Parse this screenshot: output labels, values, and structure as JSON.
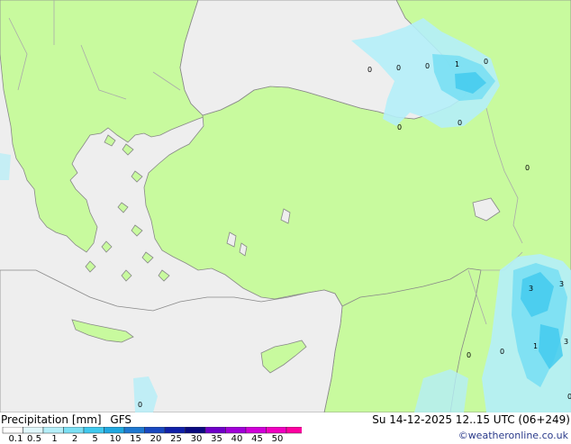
{
  "map": {
    "colors": {
      "land": "#c8fa9e",
      "sea": "#eeeeee",
      "coast": "#888888",
      "border": "#aaaaaa"
    },
    "precip_labels": [
      "0",
      "0",
      "0",
      "1",
      "0",
      "0",
      "0",
      "0",
      "3",
      "3",
      "3",
      "1",
      "0",
      "0",
      "0",
      "0"
    ]
  },
  "footer": {
    "title": "Precipitation [mm]",
    "model": "GFS",
    "run_time": "Su 14-12-2025 12..15 UTC (06+249)",
    "credit": "©weatheronline.co.uk"
  },
  "legend": {
    "ticks": [
      "0.1",
      "0.5",
      "1",
      "2",
      "5",
      "10",
      "15",
      "20",
      "25",
      "30",
      "35",
      "40",
      "45",
      "50"
    ],
    "colors": [
      "#ffffff",
      "#e0f7fb",
      "#b4eef8",
      "#7adff3",
      "#3fc9ee",
      "#20a8e0",
      "#1e78d0",
      "#1848c0",
      "#1020a8",
      "#0a0a80",
      "#6e00c8",
      "#a000d8",
      "#d000d8",
      "#f000c0",
      "#ff00a0"
    ]
  }
}
